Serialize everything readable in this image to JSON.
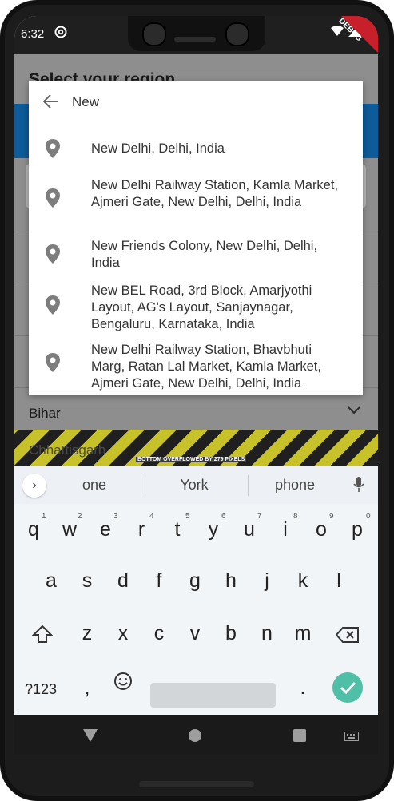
{
  "status": {
    "time": "6:32",
    "debug_label": "DEBUG"
  },
  "page": {
    "title": "Select your region",
    "rows": [
      "Bihar",
      "Chhattisgarh"
    ],
    "overflow_warning": "BOTTOM OVERFLOWED BY 279 PIXELS"
  },
  "search": {
    "value": "New",
    "results": [
      "New Delhi, Delhi, India",
      "New Delhi Railway Station, Kamla Market, Ajmeri Gate, New Delhi, Delhi, India",
      "New Friends Colony, New Delhi, Delhi, India",
      "New BEL Road, 3rd Block, Amarjyothi Layout, AG's Layout, Sanjaynagar, Bengaluru, Karnataka, India",
      "New Delhi Railway Station, Bhavbhuti Marg, Ratan Lal Market, Kamla Market, Ajmeri Gate, New Delhi, Delhi, India"
    ]
  },
  "keyboard": {
    "suggestions": [
      "one",
      "York",
      "phone"
    ],
    "row1": [
      "q",
      "w",
      "e",
      "r",
      "t",
      "y",
      "u",
      "i",
      "o",
      "p"
    ],
    "row1_hints": [
      "1",
      "2",
      "3",
      "4",
      "5",
      "6",
      "7",
      "8",
      "9",
      "0"
    ],
    "row2": [
      "a",
      "s",
      "d",
      "f",
      "g",
      "h",
      "j",
      "k",
      "l"
    ],
    "row3": [
      "z",
      "x",
      "c",
      "v",
      "b",
      "n",
      "m"
    ],
    "symbols_label": "?123",
    "comma": ",",
    "period": "."
  },
  "icons": {
    "back": "arrow-back-icon",
    "pin": "location-pin-icon",
    "mic": "mic-icon",
    "shift": "shift-icon",
    "backspace": "backspace-icon",
    "emoji": "emoji-icon",
    "enter": "check-icon"
  },
  "colors": {
    "accent": "#0d5b98",
    "enter": "#4fbfa7",
    "debug": "#c7202a"
  }
}
